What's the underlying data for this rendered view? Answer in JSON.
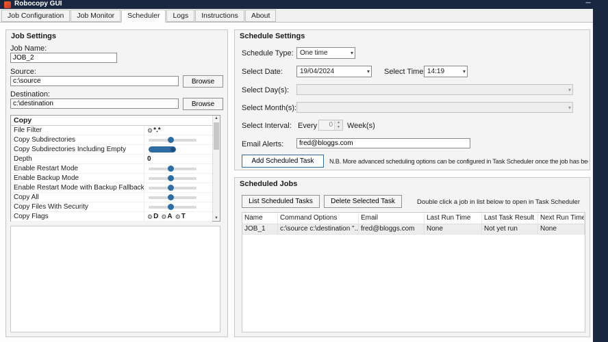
{
  "window": {
    "title": "Robocopy GUI",
    "minimize_glyph": "─"
  },
  "colors": {
    "titlebar": "#1a2740",
    "accent_blue": "#2d6da4"
  },
  "tabs": [
    {
      "label": "Job Configuration",
      "active": false
    },
    {
      "label": "Job Monitor",
      "active": false
    },
    {
      "label": "Scheduler",
      "active": true
    },
    {
      "label": "Logs",
      "active": false
    },
    {
      "label": "Instructions",
      "active": false
    },
    {
      "label": "About",
      "active": false
    }
  ],
  "job_settings": {
    "title": "Job Settings",
    "job_name_label": "Job Name:",
    "job_name_value": "JOB_2",
    "source_label": "Source:",
    "source_value": "c:\\source",
    "browse_label": "Browse",
    "destination_label": "Destination:",
    "destination_value": "c:\\destination",
    "options_header": "Copy",
    "options": [
      {
        "label": "File Filter",
        "type": "filter",
        "value": "*.*"
      },
      {
        "label": "Copy Subdirectories",
        "type": "toggle"
      },
      {
        "label": "Copy Subdirectories Including Empty",
        "type": "toggle-on"
      },
      {
        "label": "Depth",
        "type": "value",
        "value": "0"
      },
      {
        "label": "Enable Restart Mode",
        "type": "toggle"
      },
      {
        "label": "Enable Backup Mode",
        "type": "toggle"
      },
      {
        "label": "Enable Restart Mode with Backup Fallback",
        "type": "toggle"
      },
      {
        "label": "Copy All",
        "type": "toggle"
      },
      {
        "label": "Copy Files With Security",
        "type": "toggle"
      },
      {
        "label": "Copy Flags",
        "type": "flags",
        "flags": [
          "D",
          "A",
          "T"
        ]
      }
    ]
  },
  "schedule_settings": {
    "title": "Schedule Settings",
    "schedule_type_label": "Schedule Type:",
    "schedule_type_value": "One time",
    "select_date_label": "Select Date:",
    "select_date_value": "19/04/2024",
    "select_time_label": "Select Time:",
    "select_time_value": "14:19",
    "select_days_label": "Select Day(s):",
    "select_months_label": "Select Month(s):",
    "select_interval_label": "Select Interval:",
    "every_label": "Every",
    "interval_value": "0",
    "weeks_label": "Week(s)",
    "email_label": "Email Alerts:",
    "email_value": "fred@bloggs.com",
    "add_task_button": "Add Scheduled Task",
    "note": "N.B. More advanced scheduling options can be configured in Task Scheduler once the job has been added"
  },
  "scheduled_jobs": {
    "title": "Scheduled Jobs",
    "list_tasks_button": "List Scheduled Tasks",
    "delete_task_button": "Delete Selected Task",
    "hint": "Double click a job in list below to open in Task Scheduler",
    "columns": [
      "Name",
      "Command Options",
      "Email",
      "Last Run Time",
      "Last Task Result",
      "Next Run Time"
    ],
    "rows": [
      [
        "JOB_1",
        "c:\\source c:\\destination \"...",
        "fred@bloggs.com",
        "None",
        "Not yet run",
        "None"
      ]
    ]
  }
}
